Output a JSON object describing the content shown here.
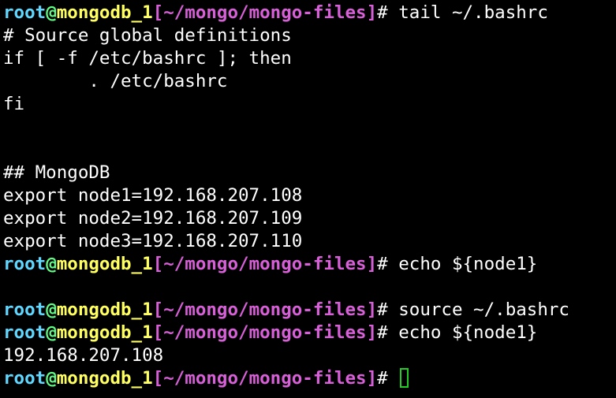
{
  "prompt": {
    "user": "root",
    "at": "@",
    "host": "mongodb_1",
    "open_bracket": "[",
    "path": "~/mongo/mongo-files",
    "close_bracket": "]",
    "symbol": "# "
  },
  "colors": {
    "background": "#000000",
    "user": "#5fd7ff",
    "at": "#5fff87",
    "host": "#ffff5f",
    "path": "#d75fd7",
    "text": "#ffffff",
    "cursor": "#22cc22"
  },
  "lines": [
    {
      "type": "prompt",
      "command": "tail ~/.bashrc"
    },
    {
      "type": "output",
      "text": "# Source global definitions"
    },
    {
      "type": "output",
      "text": "if [ -f /etc/bashrc ]; then"
    },
    {
      "type": "output",
      "text": "        . /etc/bashrc"
    },
    {
      "type": "output",
      "text": "fi"
    },
    {
      "type": "output",
      "text": ""
    },
    {
      "type": "output",
      "text": ""
    },
    {
      "type": "output",
      "text": "## MongoDB"
    },
    {
      "type": "output",
      "text": "export node1=192.168.207.108"
    },
    {
      "type": "output",
      "text": "export node2=192.168.207.109"
    },
    {
      "type": "output",
      "text": "export node3=192.168.207.110"
    },
    {
      "type": "prompt",
      "command": "echo ${node1}"
    },
    {
      "type": "output",
      "text": ""
    },
    {
      "type": "prompt",
      "command": "source ~/.bashrc"
    },
    {
      "type": "prompt",
      "command": "echo ${node1}"
    },
    {
      "type": "output",
      "text": "192.168.207.108"
    },
    {
      "type": "prompt",
      "command": "",
      "cursor": true
    }
  ]
}
